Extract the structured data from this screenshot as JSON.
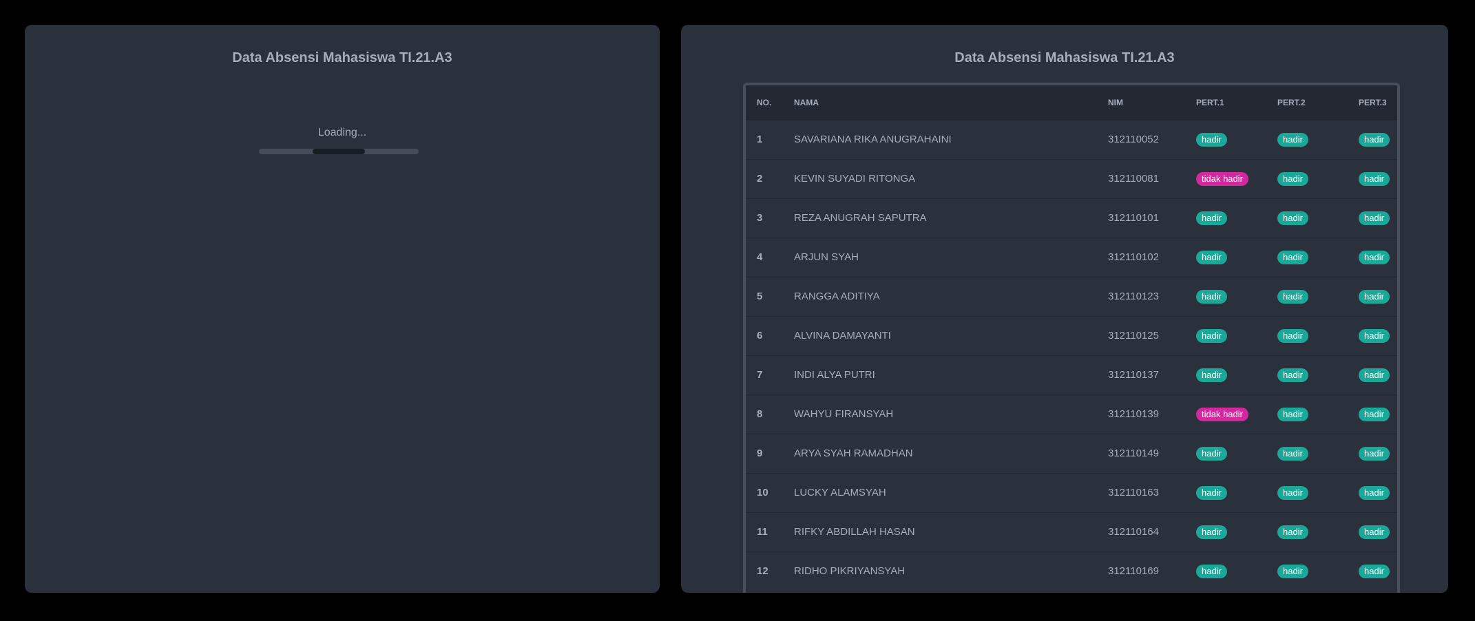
{
  "left_panel": {
    "title": "Data Absensi Mahasiswa TI.21.A3",
    "loading_text": "Loading...",
    "progress_value": 0.5
  },
  "right_panel": {
    "title": "Data Absensi Mahasiswa TI.21.A3",
    "table": {
      "headers": {
        "no": "NO.",
        "nama": "NAMA",
        "nim": "NIM",
        "pert1": "PERT.1",
        "pert2": "PERT.2",
        "pert3": "PERT.3"
      },
      "rows": [
        {
          "no": "1",
          "nama": "SAVARIANA RIKA ANUGRAHAINI",
          "nim": "312110052",
          "pert1": "hadir",
          "pert2": "hadir",
          "pert3": "hadir"
        },
        {
          "no": "2",
          "nama": "KEVIN SUYADI RITONGA",
          "nim": "312110081",
          "pert1": "tidak hadir",
          "pert2": "hadir",
          "pert3": "hadir"
        },
        {
          "no": "3",
          "nama": "REZA ANUGRAH SAPUTRA",
          "nim": "312110101",
          "pert1": "hadir",
          "pert2": "hadir",
          "pert3": "hadir"
        },
        {
          "no": "4",
          "nama": "ARJUN SYAH",
          "nim": "312110102",
          "pert1": "hadir",
          "pert2": "hadir",
          "pert3": "hadir"
        },
        {
          "no": "5",
          "nama": "RANGGA ADITIYA",
          "nim": "312110123",
          "pert1": "hadir",
          "pert2": "hadir",
          "pert3": "hadir"
        },
        {
          "no": "6",
          "nama": "ALVINA DAMAYANTI",
          "nim": "312110125",
          "pert1": "hadir",
          "pert2": "hadir",
          "pert3": "hadir"
        },
        {
          "no": "7",
          "nama": "INDI ALYA PUTRI",
          "nim": "312110137",
          "pert1": "hadir",
          "pert2": "hadir",
          "pert3": "hadir"
        },
        {
          "no": "8",
          "nama": "WAHYU FIRANSYAH",
          "nim": "312110139",
          "pert1": "tidak hadir",
          "pert2": "hadir",
          "pert3": "hadir"
        },
        {
          "no": "9",
          "nama": "ARYA SYAH RAMADHAN",
          "nim": "312110149",
          "pert1": "hadir",
          "pert2": "hadir",
          "pert3": "hadir"
        },
        {
          "no": "10",
          "nama": "LUCKY ALAMSYAH",
          "nim": "312110163",
          "pert1": "hadir",
          "pert2": "hadir",
          "pert3": "hadir"
        },
        {
          "no": "11",
          "nama": "RIFKY ABDILLAH HASAN",
          "nim": "312110164",
          "pert1": "hadir",
          "pert2": "hadir",
          "pert3": "hadir"
        },
        {
          "no": "12",
          "nama": "RIDHO PIKRIYANSYAH",
          "nim": "312110169",
          "pert1": "hadir",
          "pert2": "hadir",
          "pert3": "hadir"
        }
      ]
    }
  },
  "colors": {
    "background": "#000000",
    "panel": "#2a303c",
    "text": "#a6adbb",
    "badge_hadir": "#1aa999",
    "badge_tidak_hadir": "#d3289e"
  }
}
